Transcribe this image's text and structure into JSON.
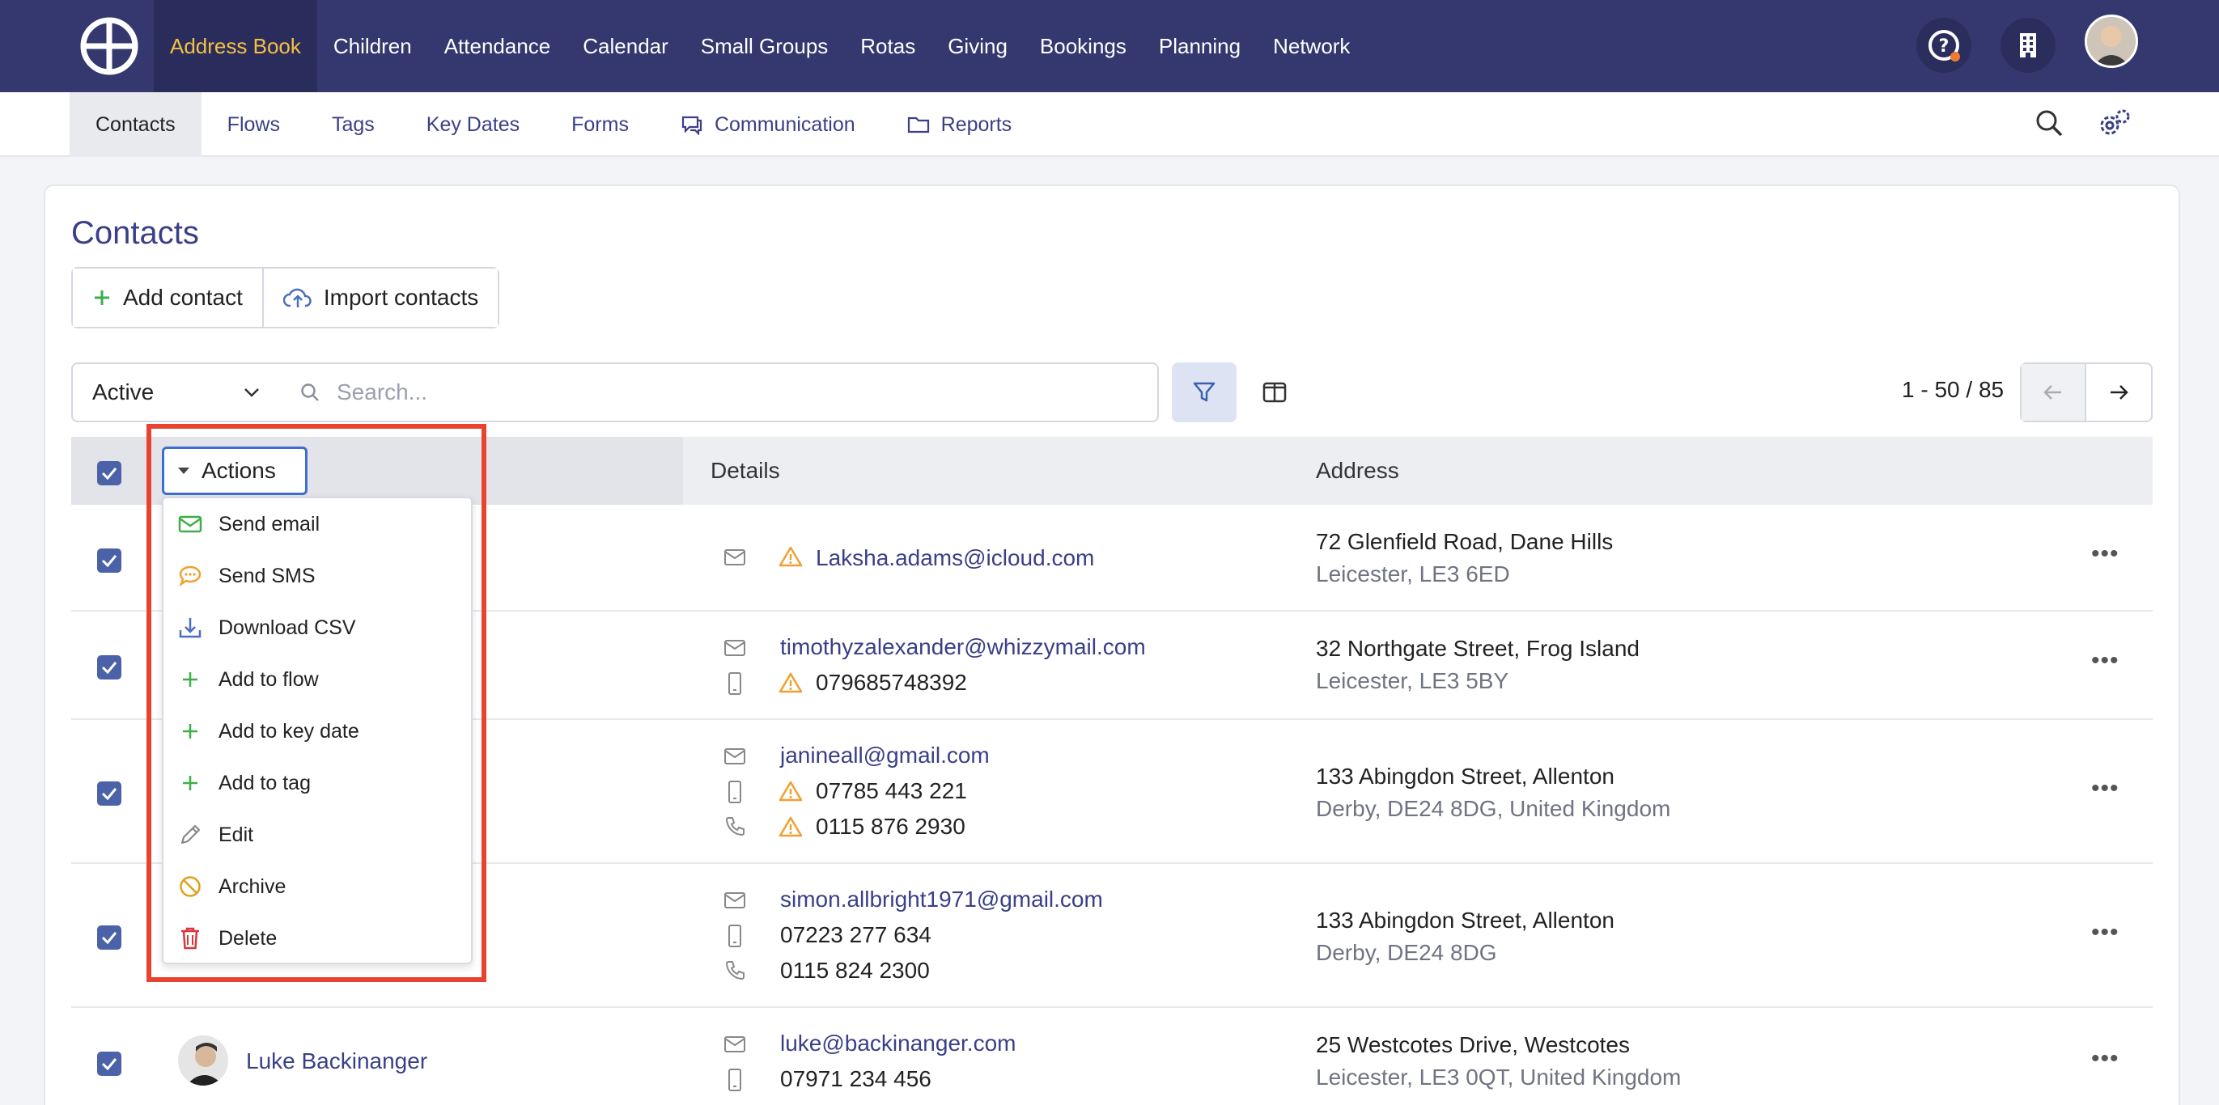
{
  "topnav": {
    "items": [
      {
        "label": "Address Book",
        "active": true
      },
      {
        "label": "Children"
      },
      {
        "label": "Attendance"
      },
      {
        "label": "Calendar"
      },
      {
        "label": "Small Groups"
      },
      {
        "label": "Rotas"
      },
      {
        "label": "Giving"
      },
      {
        "label": "Bookings"
      },
      {
        "label": "Planning"
      },
      {
        "label": "Network"
      }
    ],
    "icons": [
      "help-icon",
      "building-icon",
      "user-avatar"
    ]
  },
  "subnav": {
    "items": [
      {
        "label": "Contacts",
        "active": true
      },
      {
        "label": "Flows"
      },
      {
        "label": "Tags"
      },
      {
        "label": "Key Dates"
      },
      {
        "label": "Forms"
      },
      {
        "label": "Communication",
        "icon": "chat-icon"
      },
      {
        "label": "Reports",
        "icon": "folder-icon"
      }
    ]
  },
  "page": {
    "title": "Contacts",
    "add_contact": "Add contact",
    "import_contacts": "Import contacts"
  },
  "filters": {
    "status": "Active",
    "search_placeholder": "Search...",
    "pager": "1 - 50 / 85"
  },
  "table": {
    "headers": {
      "details": "Details",
      "address": "Address"
    },
    "actions_label": "Actions"
  },
  "actions_menu": [
    {
      "label": "Send email",
      "icon": "envelope-icon",
      "color": "#3fae49"
    },
    {
      "label": "Send SMS",
      "icon": "chat-bubble-icon",
      "color": "#f0a030"
    },
    {
      "label": "Download CSV",
      "icon": "download-icon",
      "color": "#4b6fbf"
    },
    {
      "label": "Add to flow",
      "icon": "plus-icon",
      "color": "#3fae49"
    },
    {
      "label": "Add to key date",
      "icon": "plus-icon",
      "color": "#3fae49"
    },
    {
      "label": "Add to tag",
      "icon": "plus-icon",
      "color": "#3fae49"
    },
    {
      "label": "Edit",
      "icon": "pencil-icon",
      "color": "#888888"
    },
    {
      "label": "Archive",
      "icon": "ban-icon",
      "color": "#e0a020"
    },
    {
      "label": "Delete",
      "icon": "trash-icon",
      "color": "#d9363e"
    }
  ],
  "rows": [
    {
      "email": "Laksha.adams@icloud.com",
      "addr1": "72 Glenfield Road, Dane Hills",
      "addr2": "Leicester, LE3 6ED"
    },
    {
      "email": "timothyzalexander@whizzymail.com",
      "mobile": "079685748392",
      "addr1": "32 Northgate Street, Frog Island",
      "addr2": "Leicester, LE3 5BY"
    },
    {
      "email": "janineall@gmail.com",
      "mobile": "07785 443 221",
      "phone": "0115 876 2930",
      "addr1": "133 Abingdon Street, Allenton",
      "addr2": "Derby, DE24 8DG, United Kingdom"
    },
    {
      "email": "simon.allbright1971@gmail.com",
      "mobile": "07223 277 634",
      "phone": "0115 824 2300",
      "addr1": "133 Abingdon Street, Allenton",
      "addr2": "Derby, DE24 8DG"
    },
    {
      "name": "Luke Backinanger",
      "email": "luke@backinanger.com",
      "mobile": "07971 234 456",
      "addr1": "25 Westcotes Drive, Westcotes",
      "addr2": "Leicester, LE3 0QT, United Kingdom"
    }
  ],
  "colors": {
    "nav_bg": "#34386e",
    "accent": "#3a3f86",
    "active_nav_text": "#f5c044",
    "highlight": "#e8432e",
    "warning": "#f0a030"
  }
}
